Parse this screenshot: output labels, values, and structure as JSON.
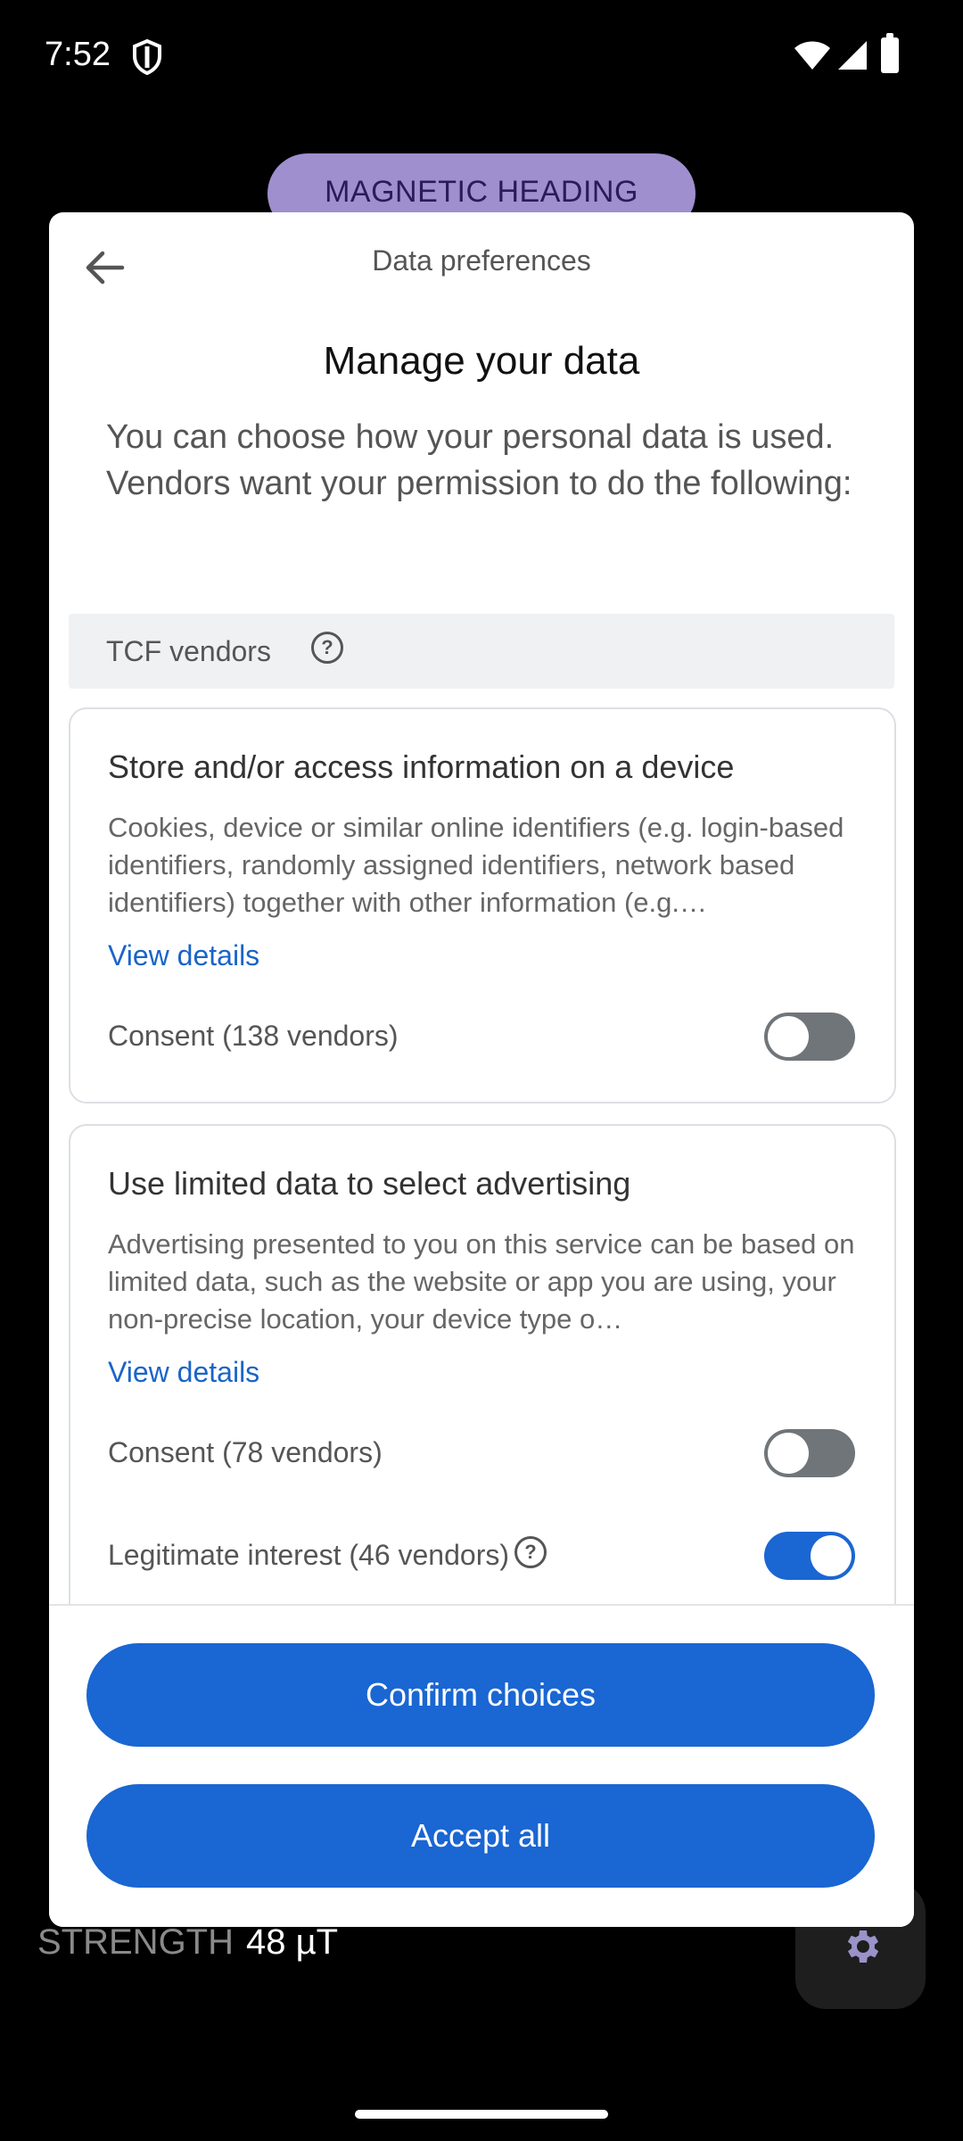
{
  "status_bar": {
    "time": "7:52"
  },
  "background_app": {
    "mode_pill": "MAGNETIC HEADING",
    "strength_label": "STRENGTH",
    "strength_value": "48 µT"
  },
  "dialog": {
    "header_title": "Data preferences",
    "main_title": "Manage your data",
    "intro": "You can choose how your personal data is used. Vendors want your permission to do the following:",
    "section_label": "TCF vendors",
    "purposes": [
      {
        "title": "Store and/or access information on a device",
        "description": "Cookies, device or similar online identifiers (e.g. login-based identifiers, randomly assigned identifiers, network based identifiers) together with other information (e.g.…",
        "view_details": "View details",
        "consent_label": "Consent (138 vendors)",
        "consent_on": false
      },
      {
        "title": "Use limited data to select advertising",
        "description": "Advertising presented to you on this service can be based on limited data, such as the website or app you are using, your non-precise location, your device type o…",
        "view_details": "View details",
        "consent_label": "Consent (78 vendors)",
        "consent_on": false,
        "legit_label": "Legitimate interest (46 vendors)",
        "legit_on": true
      }
    ],
    "confirm_button": "Confirm choices",
    "accept_button": "Accept all"
  },
  "colors": {
    "accent": "#1a66d2",
    "pill": "#9f8fce",
    "toggle_off": "#707579"
  }
}
